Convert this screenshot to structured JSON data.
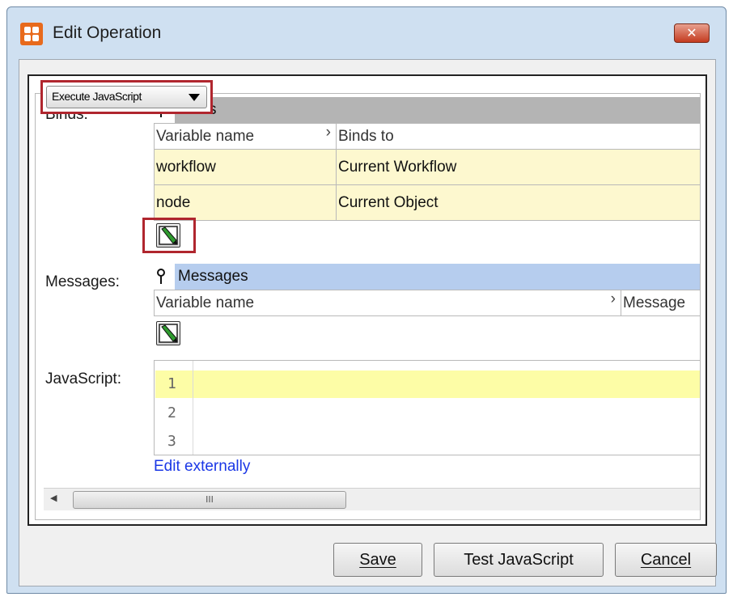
{
  "window": {
    "title": "Edit Operation",
    "close_glyph": "✕"
  },
  "operation_type": {
    "selected": "Execute JavaScript"
  },
  "binds": {
    "label": "Binds:",
    "header": "Binds",
    "columns": [
      "Variable name",
      "Binds to"
    ],
    "rows": [
      {
        "variable": "workflow",
        "binds_to": "Current Workflow"
      },
      {
        "variable": "node",
        "binds_to": "Current Object"
      }
    ]
  },
  "messages": {
    "label": "Messages:",
    "header": "Messages",
    "columns": [
      "Variable name",
      "Message"
    ]
  },
  "javascript": {
    "label": "JavaScript:",
    "line_numbers": [
      "1",
      "2",
      "3"
    ],
    "edit_link": "Edit externally"
  },
  "scrollbar": {
    "left_glyph": "◀",
    "right_glyph": "▶",
    "thumb_grip": "III"
  },
  "buttons": {
    "save": "Save",
    "test": "Test JavaScript",
    "cancel": "Cancel"
  },
  "colors": {
    "binds_header": "#b4b4b4",
    "messages_header": "#b6cdee",
    "row_fill": "#fdf8cf",
    "highlight_box": "#b0262e",
    "link": "#1a37e6",
    "app_icon": "#e86a1c"
  },
  "icons": [
    "app-logo-icon",
    "close-icon",
    "dropdown-arrow-icon",
    "pin-icon",
    "edit-icon",
    "scroll-left-icon",
    "scroll-right-icon"
  ]
}
